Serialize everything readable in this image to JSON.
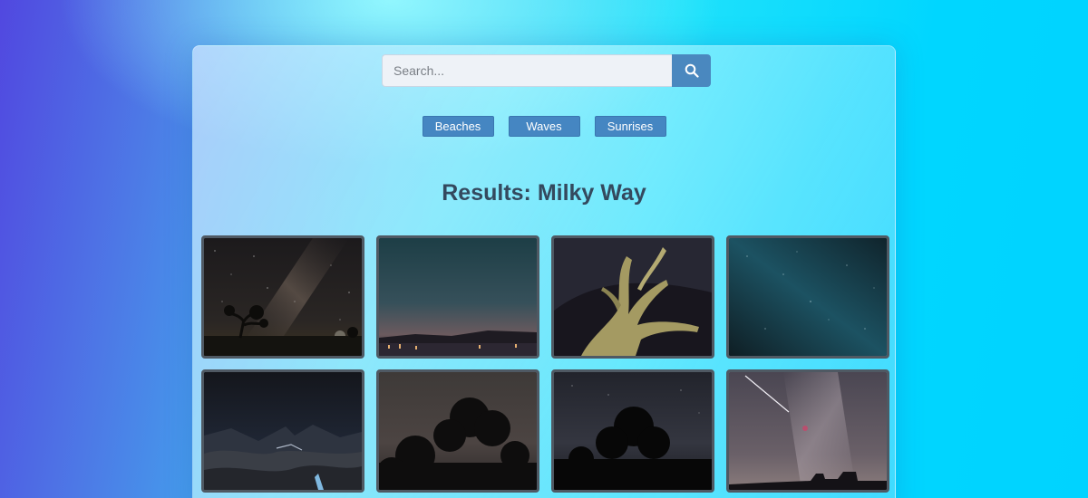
{
  "search": {
    "placeholder": "Search...",
    "value": "",
    "button_icon": "search-icon"
  },
  "categories": [
    "Beaches",
    "Waves",
    "Sunrises"
  ],
  "results": {
    "title": "Results: Milky Way"
  },
  "images": [
    {
      "subject": "milky-way-tree-silhouette"
    },
    {
      "subject": "teal-sky-over-lake-lights"
    },
    {
      "subject": "twisted-driftwood-night"
    },
    {
      "subject": "teal-milky-way-stars"
    },
    {
      "subject": "mountains-waterfall-night"
    },
    {
      "subject": "tree-silhouette-starry-sky"
    },
    {
      "subject": "dark-tree-starry-sky"
    },
    {
      "subject": "milky-way-meteor"
    }
  ],
  "colors": {
    "accent": "#4586c2",
    "title": "#34495e",
    "thumb_border": "#4f5963"
  }
}
